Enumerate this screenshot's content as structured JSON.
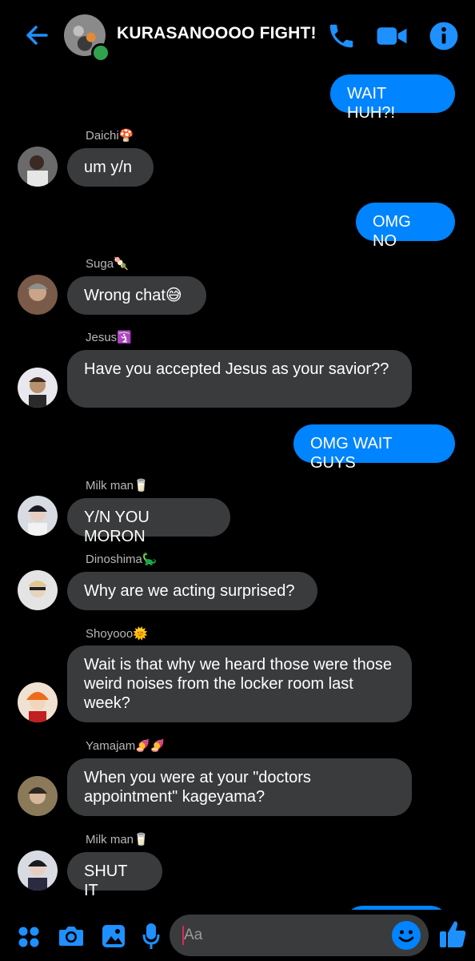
{
  "header": {
    "title": "KURASANOOOO FIGHT!"
  },
  "messages": {
    "m1": {
      "text": "WAIT HUH?!"
    },
    "m2": {
      "sender": "Daichi🍄",
      "text": "um y/n"
    },
    "m3": {
      "text": "OMG NO"
    },
    "m4": {
      "sender": "Suga🍡",
      "text": "Wrong chat😅"
    },
    "m5": {
      "sender": "Jesus🛐",
      "text": "Have you accepted Jesus as your savior??"
    },
    "m6": {
      "text": "OMG WAIT GUYS"
    },
    "m7": {
      "sender": "Milk man🥛",
      "text": "Y/N YOU MORON"
    },
    "m8": {
      "sender": "Dinoshima🦕",
      "text": "Why are we acting surprised?"
    },
    "m9": {
      "sender": "Shoyooo🌞",
      "text": "Wait is that why we heard those were those weird noises from the locker room last week?"
    },
    "m10": {
      "sender": "Yamajam🍠🍠",
      "text": "When you were at your \"doctors appointment\" kageyama?"
    },
    "m11": {
      "sender": "Milk man🥛",
      "text": "SHUT IT"
    }
  },
  "composer": {
    "placeholder": "Aa"
  },
  "colors": {
    "accent": "#0084ff",
    "incoming_bubble": "#3a3b3c",
    "background": "#000000",
    "online": "#31a24c"
  }
}
